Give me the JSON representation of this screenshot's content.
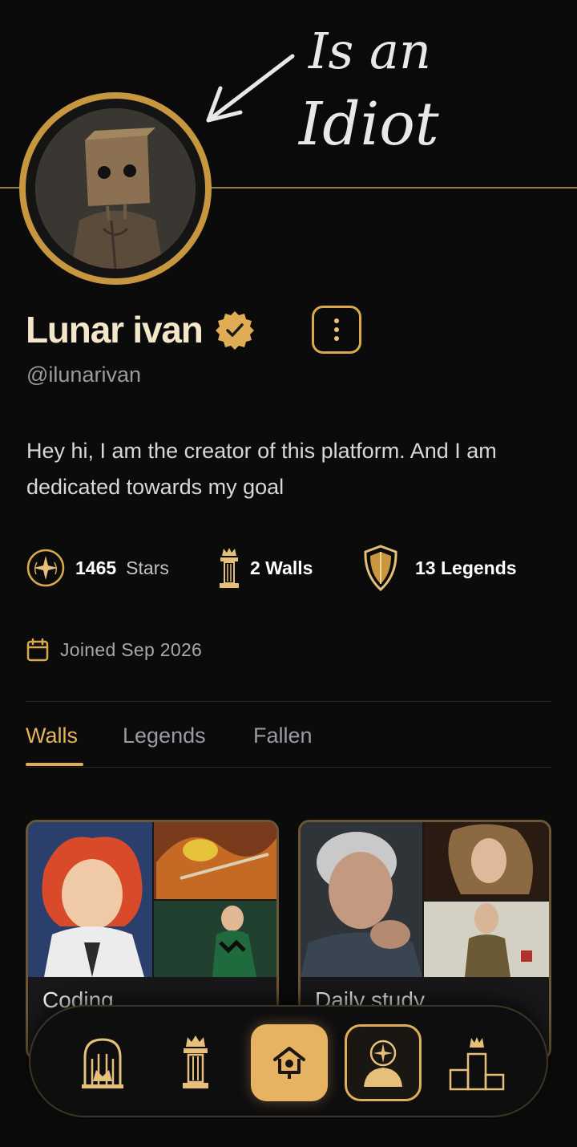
{
  "banner": {
    "doodle_text_line1": "Is an",
    "doodle_text_line2": "Idiot"
  },
  "profile": {
    "display_name": "Lunar ivan",
    "handle": "@ilunarivan",
    "bio": "Hey hi, I am the creator of this platform. And I am dedicated towards my goal",
    "joined": "Joined Sep 2026"
  },
  "stats": {
    "stars_value": "1465",
    "stars_label": "Stars",
    "walls": "2 Walls",
    "legends": "13 Legends"
  },
  "tabs": [
    {
      "label": "Walls",
      "active": true
    },
    {
      "label": "Legends",
      "active": false
    },
    {
      "label": "Fallen",
      "active": false
    }
  ],
  "walls": [
    {
      "title": "Coding"
    },
    {
      "title": "Daily study"
    }
  ],
  "nav": [
    {
      "icon": "gate-icon"
    },
    {
      "icon": "pillar-icon"
    },
    {
      "icon": "birdhouse-icon"
    },
    {
      "icon": "profile-star-icon"
    },
    {
      "icon": "podium-icon"
    }
  ],
  "colors": {
    "accent": "#d9a94c",
    "background": "#0b0b0c",
    "name": "#f3e6c9"
  }
}
